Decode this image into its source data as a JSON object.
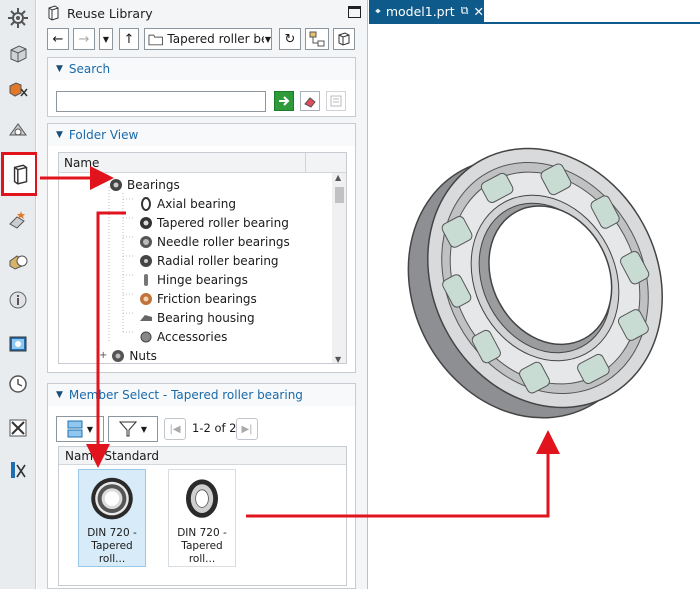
{
  "panel": {
    "title": "Reuse Library",
    "path_value": "Tapered roller bea"
  },
  "search": {
    "header": "Search",
    "input_value": ""
  },
  "folder_view": {
    "header": "Folder View",
    "column_name": "Name",
    "items": [
      {
        "label": "Bearings",
        "level": 0,
        "expand": "-"
      },
      {
        "label": "Axial bearing",
        "level": 1
      },
      {
        "label": "Tapered roller bearing",
        "level": 1
      },
      {
        "label": "Needle roller bearings",
        "level": 1
      },
      {
        "label": "Radial roller bearing",
        "level": 1
      },
      {
        "label": "Hinge bearings",
        "level": 1
      },
      {
        "label": "Friction bearings",
        "level": 1
      },
      {
        "label": "Bearing housing",
        "level": 1
      },
      {
        "label": "Accessories",
        "level": 1
      },
      {
        "label": "Nuts",
        "level": 0,
        "expand": "+"
      }
    ]
  },
  "member_select": {
    "header": "Member Select - Tapered roller bearing",
    "paging": "1-2 of 2",
    "columns": [
      "Name",
      "Standard"
    ],
    "tiles": [
      {
        "caption_line1": "DIN 720 -",
        "caption_line2": "Tapered roll...",
        "selected": true
      },
      {
        "caption_line1": "DIN 720 -",
        "caption_line2": "Tapered roll...",
        "selected": false
      }
    ]
  },
  "document_tab": {
    "label": "model1.prt"
  },
  "sidebar_icons": [
    "settings-gear-icon",
    "part-navigator-icon",
    "assembly-navigator-icon",
    "constraint-navigator-icon",
    "reuse-library-icon",
    "hd3d-tools-icon",
    "web-browser-icon",
    "info-icon",
    "system-scenes-icon",
    "history-icon",
    "process-studio-icon",
    "roles-icon"
  ],
  "colors": {
    "accent": "#0e5a8a",
    "highlight": "#e1141d",
    "section_header": "#1a6aa8"
  }
}
